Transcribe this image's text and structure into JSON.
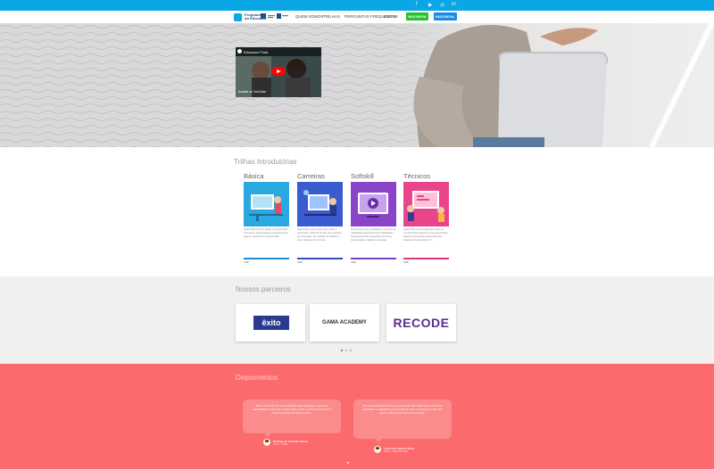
{
  "header": {
    "brand_line1": "Programa",
    "brand_line2": "do Educador",
    "nav": [
      "QUEM SOMOS",
      "TRILHAS",
      "PERGUNTAS FREQUENTES",
      "LOGIN"
    ],
    "cta_primary": "INSCREVA",
    "cta_secondary": "INSCREVA-SE",
    "social_icons": [
      "facebook-icon",
      "youtube-icon",
      "instagram-icon",
      "linkedin-icon"
    ]
  },
  "hero": {
    "video_title": "Educador Fluid",
    "video_footer": "Assistir no YouTube"
  },
  "trilhas": {
    "title": "Trilhas Introdutórias",
    "items": [
      {
        "name": "Básica",
        "bar_color": "#1d8fd8",
        "img_bg": "#29a9e0",
        "link": "VER"
      },
      {
        "name": "Carreiras",
        "bar_color": "#3b4cc0",
        "img_bg": "#3b5bd0",
        "link": "VER"
      },
      {
        "name": "Softskill",
        "bar_color": "#7d3ec0",
        "img_bg": "#8a44c8",
        "link": "VER"
      },
      {
        "name": "Técnicos",
        "bar_color": "#e0357f",
        "img_bg": "#e8458c",
        "link": "VER"
      }
    ]
  },
  "parceiros": {
    "title": "Nossos parceiros",
    "logos": [
      {
        "name": "êxito",
        "color": "#2b3a8f"
      },
      {
        "name": "GAMA ACADEMY",
        "color": "#2a2a2a"
      },
      {
        "name": "RECODE",
        "color": "#5a2d91"
      }
    ]
  },
  "depoimentos": {
    "title": "Depoimentos",
    "items": [
      {
        "author": "Rodrigo de Carvalho Souza",
        "role": "Aluno - Trilhas"
      },
      {
        "author": "Lucas dos Santos Alves",
        "role": "Aluno - Trilha Carreiras"
      }
    ]
  },
  "colors": {
    "topbar": "#0aa6e6",
    "cta_green": "#27c12a",
    "cta_blue": "#1e88e5",
    "testimonials_bg": "#fb6a6c"
  }
}
